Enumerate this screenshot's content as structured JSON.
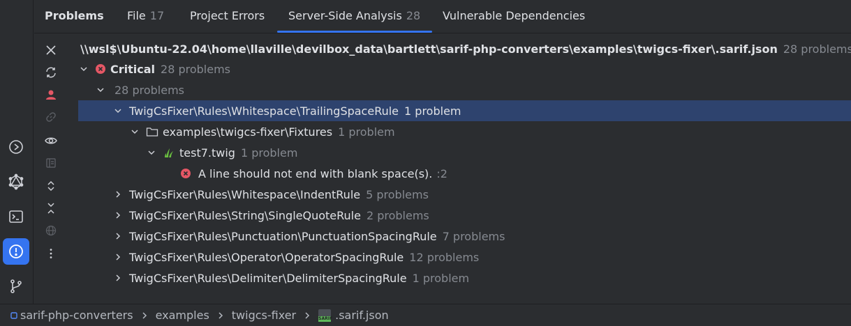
{
  "tabs": {
    "title": "Problems",
    "items": [
      {
        "label": "File",
        "count": "17"
      },
      {
        "label": "Project Errors",
        "count": ""
      },
      {
        "label": "Server-Side Analysis",
        "count": "28"
      },
      {
        "label": "Vulnerable Dependencies",
        "count": ""
      }
    ],
    "active_index": 2
  },
  "activity_bar": {
    "icons": [
      "run-icon",
      "graphql-icon",
      "terminal-icon",
      "problems-icon",
      "git-icon"
    ],
    "active": "problems-icon"
  },
  "tool_strip": {
    "icons": [
      "close-icon",
      "refresh-icon",
      "user-icon",
      "link-icon",
      "eye-icon",
      "preview-icon",
      "expand-all-icon",
      "collapse-all-icon",
      "globe-icon",
      "more-icon"
    ]
  },
  "tree": {
    "root_path": "\\\\wsl$\\Ubuntu-22.04\\home\\llaville\\devilbox_data\\bartlett\\sarif-php-converters\\examples\\twigcs-fixer\\.sarif.json",
    "root_count": "28 problems",
    "critical_label": "Critical",
    "critical_count": "28 problems",
    "group_count": "28 problems",
    "selected_rule": "TwigCsFixer\\Rules\\Whitespace\\TrailingSpaceRule",
    "selected_rule_count": "1 problem",
    "folder": "examples\\twigcs-fixer\\Fixtures",
    "folder_count": "1 problem",
    "file": "test7.twig",
    "file_count": "1 problem",
    "message": "A line should not end with blank space(s).",
    "message_line": ":2",
    "rules": [
      {
        "name": "TwigCsFixer\\Rules\\Whitespace\\IndentRule",
        "count": "5 problems"
      },
      {
        "name": "TwigCsFixer\\Rules\\String\\SingleQuoteRule",
        "count": "2 problems"
      },
      {
        "name": "TwigCsFixer\\Rules\\Punctuation\\PunctuationSpacingRule",
        "count": "7 problems"
      },
      {
        "name": "TwigCsFixer\\Rules\\Operator\\OperatorSpacingRule",
        "count": "12 problems"
      },
      {
        "name": "TwigCsFixer\\Rules\\Delimiter\\DelimiterSpacingRule",
        "count": "1 problem"
      }
    ]
  },
  "status_bar": {
    "crumbs": [
      "sarif-php-converters",
      "examples",
      "twigcs-fixer",
      ".sarif.json"
    ],
    "file_badge": "SARIF"
  },
  "colors": {
    "background": "#2b2d30",
    "selection": "#2e436e",
    "accent": "#3574f0",
    "error": "#e55765",
    "muted": "#868a91"
  }
}
